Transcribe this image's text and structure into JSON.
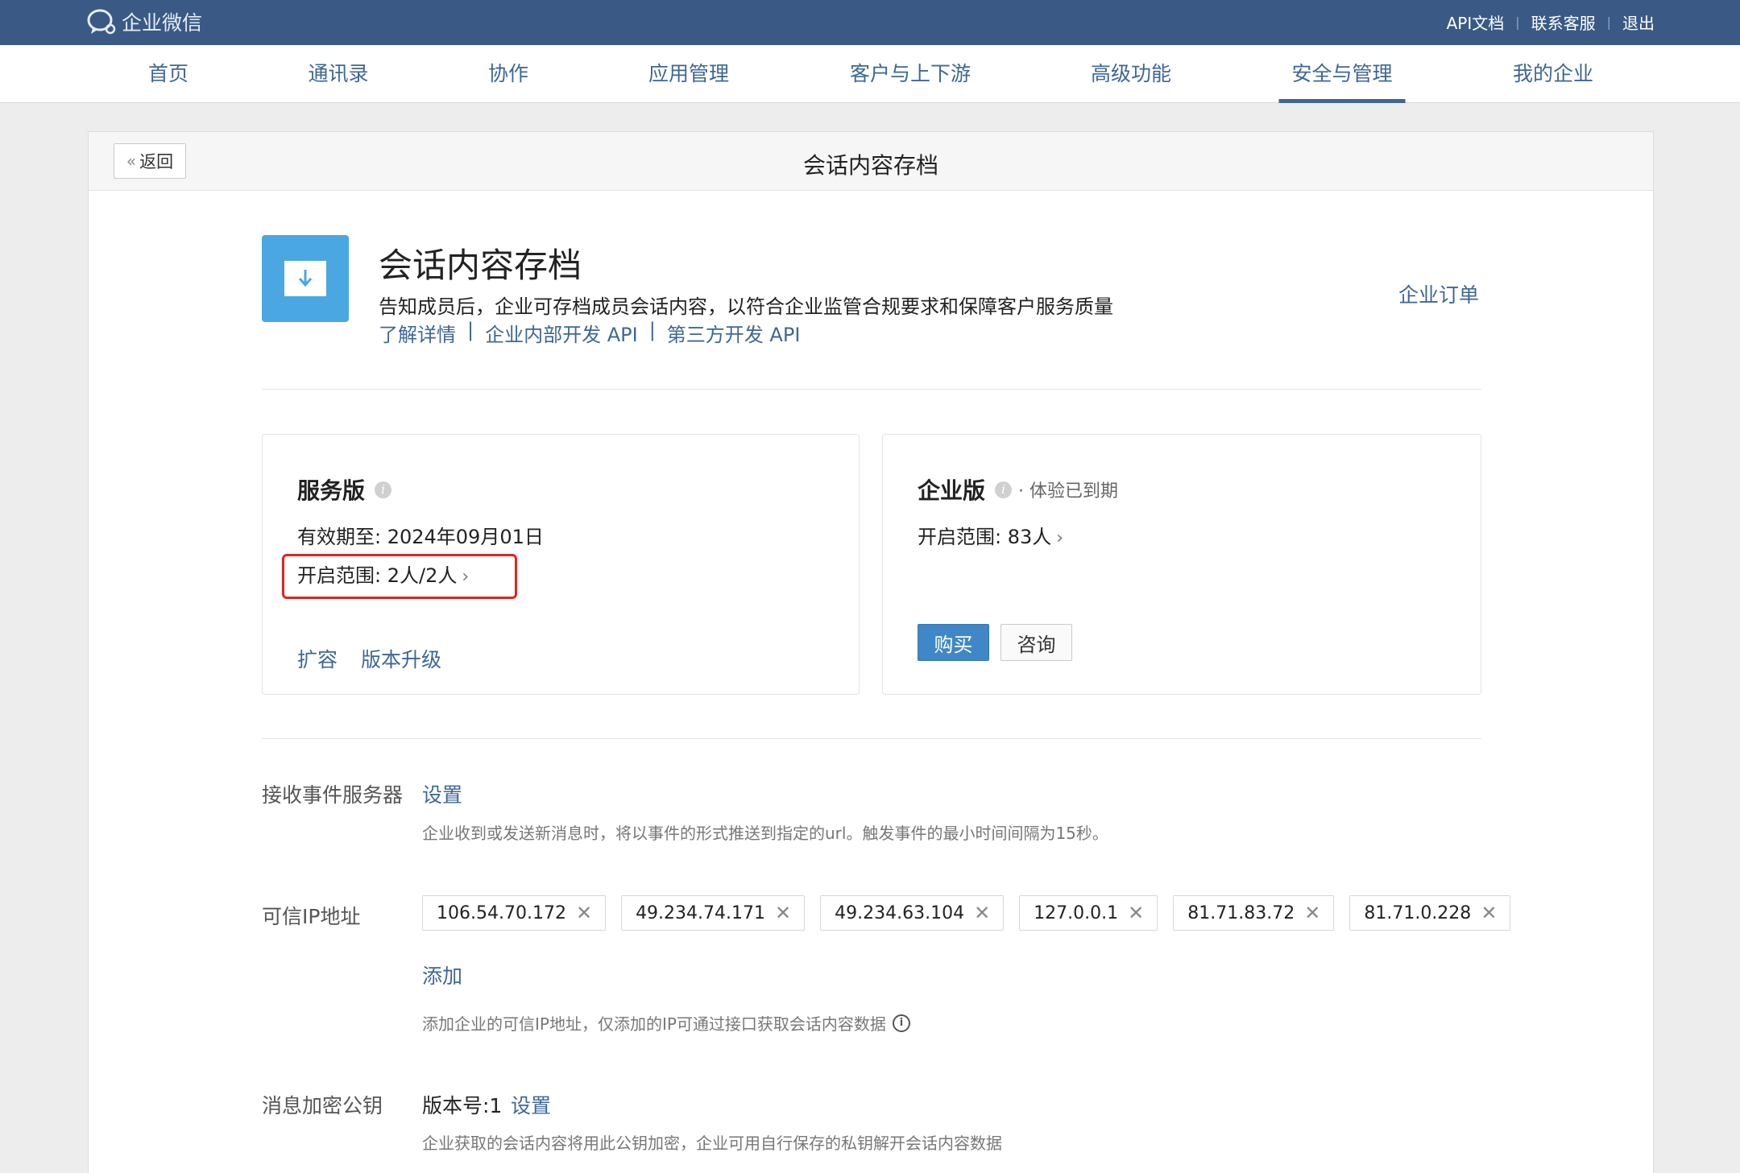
{
  "topbar": {
    "brand": "企业微信",
    "links": [
      "API文档",
      "联系客服",
      "退出"
    ]
  },
  "nav": {
    "items": [
      "首页",
      "通讯录",
      "协作",
      "应用管理",
      "客户与上下游",
      "高级功能",
      "安全与管理",
      "我的企业"
    ],
    "active": "安全与管理"
  },
  "panel": {
    "back_label": "返回",
    "title": "会话内容存档"
  },
  "app": {
    "name": "会话内容存档",
    "description": "告知成员后，企业可存档成员会话内容，以符合企业监管合规要求和保障客户服务质量",
    "links": [
      "了解详情",
      "企业内部开发 API",
      "第三方开发 API"
    ],
    "link_separator": "|",
    "order_link": "企业订单",
    "icon": "download-box-icon",
    "icon_color": "#4aa7e2"
  },
  "service_card": {
    "title": "服务版",
    "expiry": "有效期至: 2024年09月01日",
    "scope": "开启范围: 2人/2人",
    "actions": [
      "扩容",
      "版本升级"
    ],
    "highlight_color": "#e0251b"
  },
  "enterprise_card": {
    "title": "企业版",
    "status": "· 体验已到期",
    "scope": "开启范围: 83人",
    "buy_label": "购买",
    "consult_label": "咨询"
  },
  "event_server": {
    "label": "接收事件服务器",
    "action": "设置",
    "hint": "企业收到或发送新消息时，将以事件的形式推送到指定的url。触发事件的最小时间间隔为15秒。"
  },
  "trusted_ip": {
    "label": "可信IP地址",
    "ips": [
      "106.54.70.172",
      "49.234.74.171",
      "49.234.63.104",
      "127.0.0.1",
      "81.71.83.72",
      "81.71.0.228"
    ],
    "add_label": "添加",
    "hint": "添加企业的可信IP地址，仅添加的IP可通过接口获取会话内容数据"
  },
  "encryption": {
    "label": "消息加密公钥",
    "version": "版本号:1",
    "action": "设置",
    "hint": "企业获取的会话内容将用此公钥加密，企业可用自行保存的私钥解开会话内容数据"
  },
  "colors": {
    "topbar": "#3a5a85",
    "link": "#3e6795",
    "primary_button": "#3f87c7"
  }
}
